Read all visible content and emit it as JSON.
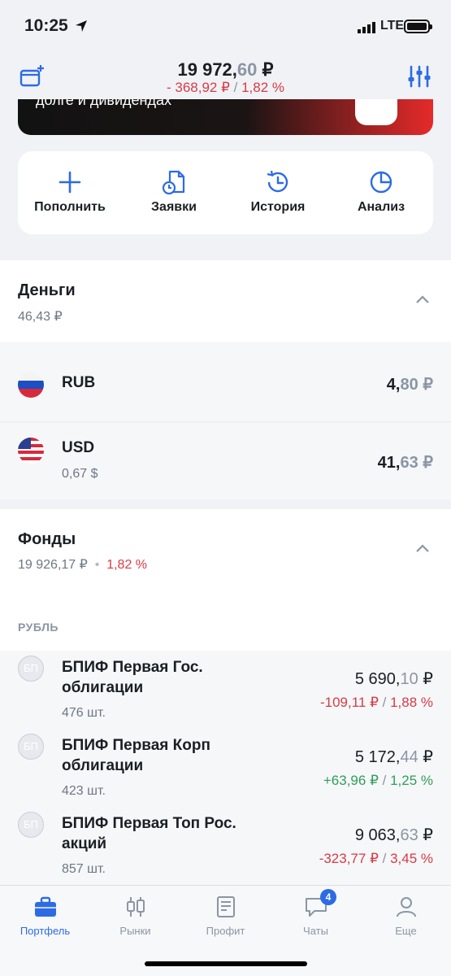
{
  "status_bar": {
    "time": "10:25",
    "network": "LTE"
  },
  "header": {
    "total_int": "19 972,",
    "total_dec": "60",
    "total_cur": " ₽",
    "delta_abs": "- 368,92 ₽",
    "delta_sep": " / ",
    "delta_pct": "1,82 %"
  },
  "banner": {
    "text": "долге и дивидендах"
  },
  "actions": [
    {
      "label": "Пополнить",
      "icon": "plus-icon"
    },
    {
      "label": "Заявки",
      "icon": "orders-icon"
    },
    {
      "label": "История",
      "icon": "history-icon"
    },
    {
      "label": "Анализ",
      "icon": "pie-chart-icon"
    }
  ],
  "money": {
    "title": "Деньги",
    "total": "46,43 ₽",
    "items": [
      {
        "currency": "RUB",
        "sub": "",
        "val_int": "4,",
        "val_dec": "80",
        "val_cur": " ₽"
      },
      {
        "currency": "USD",
        "sub": "0,67 $",
        "val_int": "41,",
        "val_dec": "63",
        "val_cur": " ₽"
      }
    ]
  },
  "funds": {
    "title": "Фонды",
    "total": "19 926,17 ₽",
    "dot": "•",
    "total_pct": "1,82 %",
    "group_label": "РУБЛЬ",
    "items": [
      {
        "icon_text": "БП",
        "name": "БПИФ Первая Гос. облигации",
        "qty": "476 шт.",
        "val_int": "5 690,",
        "val_dec": "10",
        "val_cur": " ₽",
        "chg_abs": "-109,11 ₽",
        "chg_pct": "1,88 %",
        "trend": "neg"
      },
      {
        "icon_text": "БП",
        "name": "БПИФ Первая Корп облигации",
        "qty": "423 шт.",
        "val_int": "5 172,",
        "val_dec": "44",
        "val_cur": " ₽",
        "chg_abs": "+63,96 ₽",
        "chg_pct": "1,25 %",
        "trend": "pos"
      },
      {
        "icon_text": "БП",
        "name": "БПИФ Первая Топ Рос. акций",
        "qty": "857 шт.",
        "val_int": "9 063,",
        "val_dec": "63",
        "val_cur": " ₽",
        "chg_abs": "-323,77 ₽",
        "chg_pct": "3,45 %",
        "trend": "neg"
      }
    ],
    "change_sep": " / "
  },
  "tabbar": {
    "tabs": [
      {
        "label": "Портфель",
        "icon": "briefcase-icon",
        "active": true
      },
      {
        "label": "Рынки",
        "icon": "candles-icon",
        "active": false
      },
      {
        "label": "Профит",
        "icon": "magazine-icon",
        "active": false
      },
      {
        "label": "Чаты",
        "icon": "chat-icon",
        "active": false
      },
      {
        "label": "Еще",
        "icon": "person-icon",
        "active": false
      }
    ],
    "chat_badge": "4"
  },
  "colors": {
    "accent": "#2d6be4",
    "negative": "#d93a45",
    "positive": "#2f9e5b",
    "muted": "#8b95a5"
  }
}
